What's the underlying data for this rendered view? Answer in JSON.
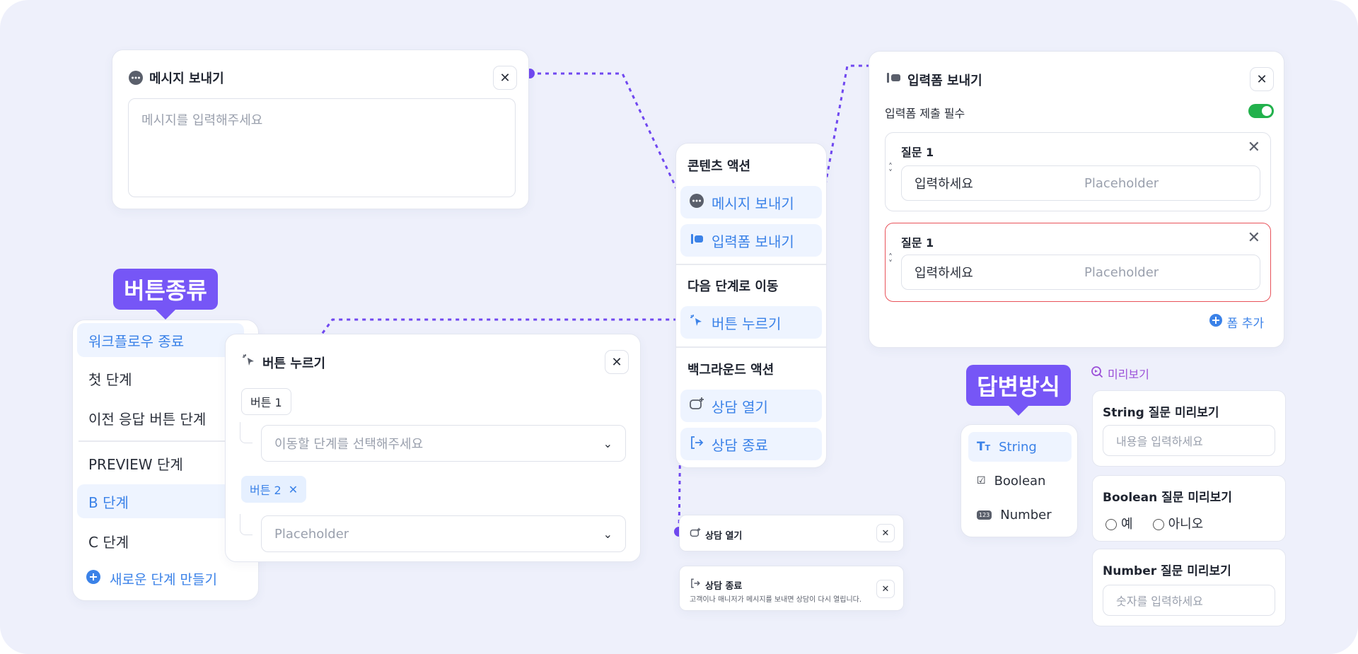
{
  "colors": {
    "accent": "#7656f6",
    "link_blue": "#3b82e8",
    "toggle_on": "#22b14c",
    "error_border": "#e8525a",
    "dashed_line": "#7048f0"
  },
  "message_card": {
    "title": "메시지 보내기",
    "placeholder": "메시지를 입력해주세요",
    "close_icon": "close-icon"
  },
  "menu": {
    "content_section": "콘텐츠 액션",
    "send_message": "메시지 보내기",
    "send_form": "입력폼 보내기",
    "next_step_section": "다음 단계로 이동",
    "press_button": "버튼 누르기",
    "background_section": "백그라운드 액션",
    "open_consult": "상담 열기",
    "close_consult": "상담 종료"
  },
  "form_card": {
    "title": "입력폼 보내기",
    "required_label": "입력폼 제출 필수",
    "required_on": true,
    "questions": [
      {
        "label": "질문 1",
        "value": "입력하세요",
        "placeholder": "Placeholder",
        "error": false
      },
      {
        "label": "질문 1",
        "value": "입력하세요",
        "placeholder": "Placeholder",
        "error": true
      }
    ],
    "add_form": "폼 추가"
  },
  "button_types_tag": "버튼종류",
  "steps": {
    "items": [
      {
        "label": "워크플로우 종료",
        "highlight": true
      },
      {
        "label": "첫 단계",
        "highlight": false
      },
      {
        "label": "이전 응답 버튼 단계",
        "highlight": false
      },
      {
        "label": "PREVIEW 단계",
        "highlight": false
      },
      {
        "label": "B 단계",
        "highlight": true
      },
      {
        "label": "C 단계",
        "highlight": false
      }
    ],
    "new_step": "새로운 단계 만들기"
  },
  "button_card": {
    "title": "버튼 누르기",
    "button1": "버튼 1",
    "button1_select": "이동할 단계를 선택해주세요",
    "button2": "버튼 2",
    "button2_select": "Placeholder"
  },
  "answer_tag": "답변방식",
  "answer_types": [
    "String",
    "Boolean",
    "Number"
  ],
  "preview": {
    "label": "미리보기",
    "string_title": "String 질문 미리보기",
    "string_placeholder": "내용을 입력하세요",
    "boolean_title": "Boolean 질문 미리보기",
    "boolean_yes": "예",
    "boolean_no": "아니오",
    "number_title": "Number 질문 미리보기",
    "number_placeholder": "숫자를 입력하세요"
  },
  "mini_open": {
    "title": "상담 열기"
  },
  "mini_close": {
    "title": "상담 종료",
    "desc": "고객이나 매니저가 메시지를 보내면 상담이 다시 열립니다."
  }
}
